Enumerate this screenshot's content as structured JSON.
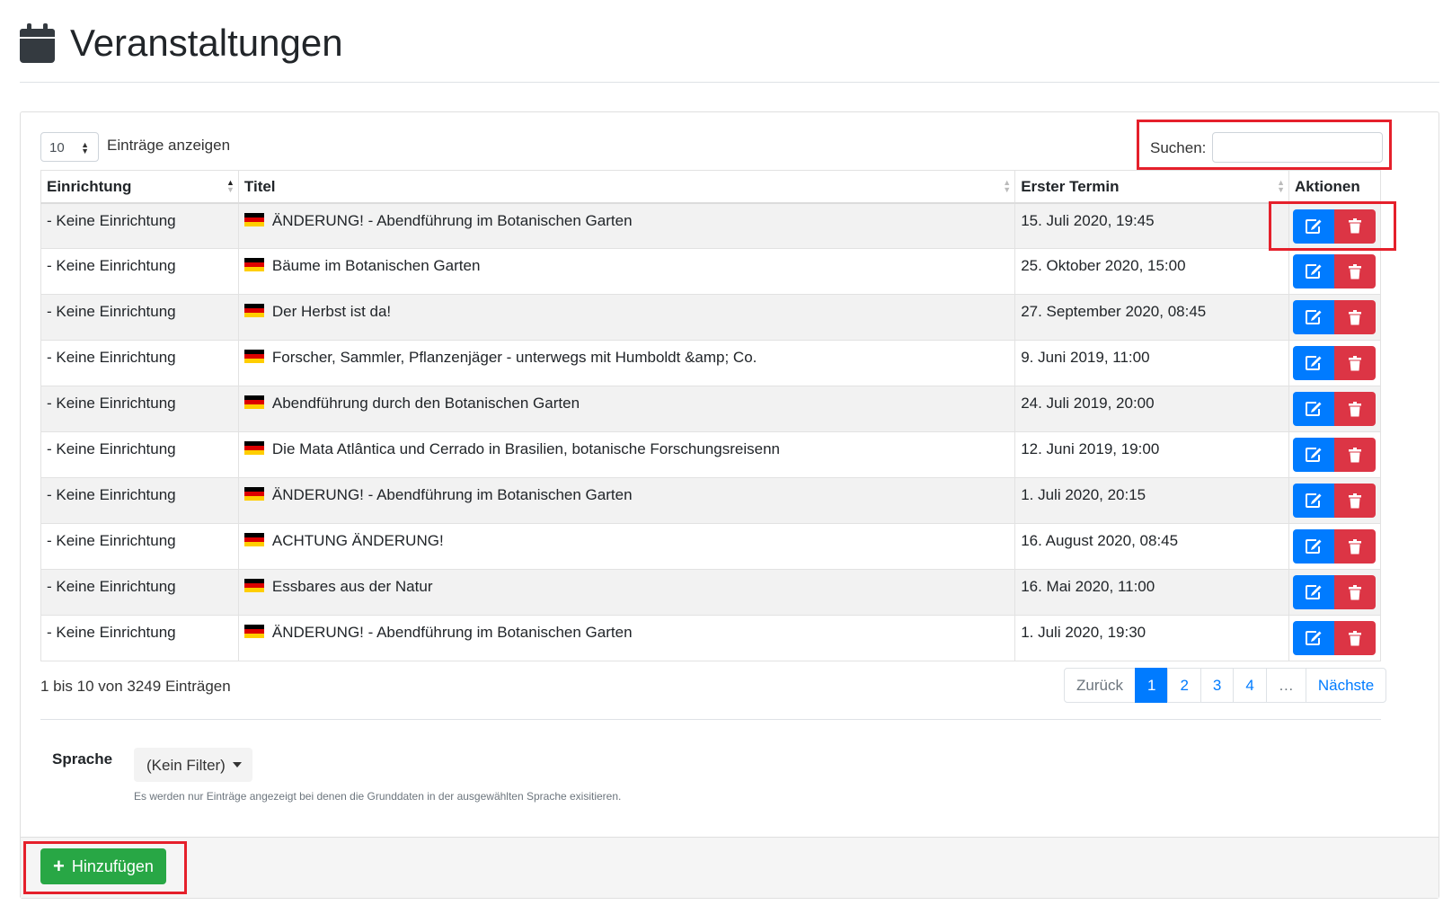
{
  "header": {
    "title": "Veranstaltungen",
    "icon": "calendar-icon"
  },
  "controls": {
    "length_value": "10",
    "length_label": "Einträge anzeigen",
    "search_label": "Suchen:",
    "search_value": ""
  },
  "table": {
    "columns": [
      "Einrichtung",
      "Titel",
      "Erster Termin",
      "Aktionen"
    ],
    "rows": [
      {
        "einrichtung": "- Keine Einrichtung",
        "titel": "ÄNDERUNG! - Abendführung im Botanischen Garten",
        "termin": "15. Juli 2020, 19:45"
      },
      {
        "einrichtung": "- Keine Einrichtung",
        "titel": "Bäume im Botanischen Garten",
        "termin": "25. Oktober 2020, 15:00"
      },
      {
        "einrichtung": "- Keine Einrichtung",
        "titel": "Der Herbst ist da!",
        "termin": "27. September 2020, 08:45"
      },
      {
        "einrichtung": "- Keine Einrichtung",
        "titel": "Forscher, Sammler, Pflanzenjäger - unterwegs mit Humboldt &amp; Co.",
        "termin": "9. Juni 2019, 11:00"
      },
      {
        "einrichtung": "- Keine Einrichtung",
        "titel": "Abendführung durch den Botanischen Garten",
        "termin": "24. Juli 2019, 20:00"
      },
      {
        "einrichtung": "- Keine Einrichtung",
        "titel": "Die Mata Atlântica und Cerrado in Brasilien, botanische Forschungsreisenn",
        "termin": "12. Juni 2019, 19:00"
      },
      {
        "einrichtung": "- Keine Einrichtung",
        "titel": "ÄNDERUNG! - Abendführung im Botanischen Garten",
        "termin": "1. Juli 2020, 20:15"
      },
      {
        "einrichtung": "- Keine Einrichtung",
        "titel": "ACHTUNG ÄNDERUNG!",
        "termin": "16. August 2020, 08:45"
      },
      {
        "einrichtung": "- Keine Einrichtung",
        "titel": "Essbares aus der Natur",
        "termin": "16. Mai 2020, 11:00"
      },
      {
        "einrichtung": "- Keine Einrichtung",
        "titel": "ÄNDERUNG! - Abendführung im Botanischen Garten",
        "termin": "1. Juli 2020, 19:30"
      }
    ]
  },
  "info": "1 bis 10 von 3249 Einträgen",
  "pagination": {
    "prev": "Zurück",
    "pages": [
      "1",
      "2",
      "3",
      "4",
      "…"
    ],
    "next": "Nächste",
    "active": "1"
  },
  "language_filter": {
    "label": "Sprache",
    "selected": "(Kein Filter)",
    "hint": "Es werden nur Einträge angezeigt bei denen die Grunddaten in der ausgewählten Sprache exisitieren."
  },
  "footer": {
    "add_label": "Hinzufügen"
  },
  "colors": {
    "primary": "#007bff",
    "danger": "#dc3545",
    "success": "#28a745",
    "highlight": "#e5202b"
  }
}
